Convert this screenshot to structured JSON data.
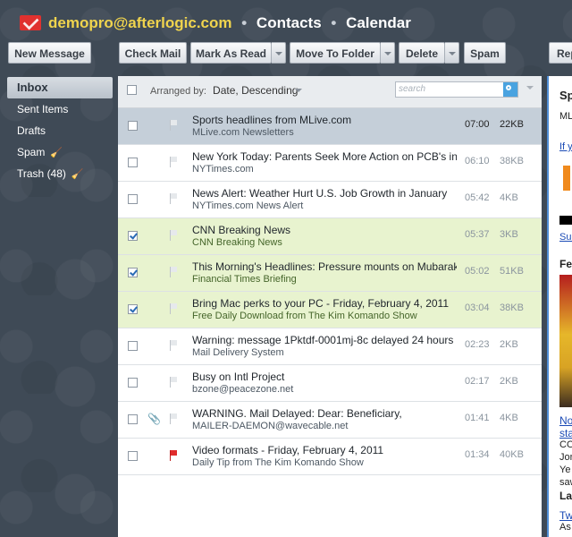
{
  "header": {
    "account": "demopro@afterlogic.com",
    "sep": "•",
    "nav": [
      "Contacts",
      "Calendar"
    ]
  },
  "toolbar": {
    "new_message": "New Message",
    "check_mail": "Check Mail",
    "mark_as_read": "Mark As Read",
    "move_to_folder": "Move To Folder",
    "delete": "Delete",
    "spam": "Spam",
    "reply_partial": "Rep"
  },
  "folders": [
    {
      "label": "Inbox"
    },
    {
      "label": "Sent Items"
    },
    {
      "label": "Drafts"
    },
    {
      "label": "Spam"
    },
    {
      "label": "Trash (48)"
    }
  ],
  "list_header": {
    "arranged_label": "Arranged by:",
    "arranged_value": "Date, Descending",
    "search_placeholder": "search"
  },
  "messages": [
    {
      "subject": "Sports headlines from MLive.com",
      "from": "MLive.com Newsletters",
      "time": "07:00",
      "size": "22KB"
    },
    {
      "subject": "New York Today: Parents Seek More Action on PCB's in Schools",
      "from": "NYTimes.com",
      "time": "06:10",
      "size": "38KB"
    },
    {
      "subject": "News Alert: Weather Hurt U.S. Job Growth in January",
      "from": "NYTimes.com News Alert",
      "time": "05:42",
      "size": "4KB"
    },
    {
      "subject": "CNN Breaking News",
      "from": "CNN Breaking News",
      "time": "05:37",
      "size": "3KB"
    },
    {
      "subject": "This Morning's Headlines: Pressure mounts on Mubarak to go, Egypt",
      "from": "Financial Times Briefing",
      "time": "05:02",
      "size": "51KB"
    },
    {
      "subject": "Bring Mac perks to your PC - Friday, February 4, 2011",
      "from": "Free Daily Download from The Kim Komando Show",
      "time": "03:04",
      "size": "38KB"
    },
    {
      "subject": "Warning: message 1Pktdf-0001mj-8c delayed 24 hours",
      "from": "Mail Delivery System",
      "time": "02:23",
      "size": "2KB"
    },
    {
      "subject": "Busy on Intl Project",
      "from": "bzone@peacezone.net",
      "time": "02:17",
      "size": "2KB"
    },
    {
      "subject": "WARNING. Mail Delayed: Dear: Beneficiary,",
      "from": "MAILER-DAEMON@wavecable.net",
      "time": "01:41",
      "size": "4KB"
    },
    {
      "subject": "Video formats - Friday, February 4, 2011",
      "from": "Daily Tip from The Kim Komando Show",
      "time": "01:34",
      "size": "40KB"
    }
  ],
  "preview": {
    "l1": "Sp",
    "l2": "ML",
    "l3": "If y",
    "l4": "Sub",
    "l5": "Fe",
    "l6": "No",
    "l7": "sta",
    "l8": "CO",
    "l9": "Jon",
    "l10": "Ye",
    "l11": "saw",
    "l12": "La",
    "l13": "Tw",
    "l14": "As"
  }
}
